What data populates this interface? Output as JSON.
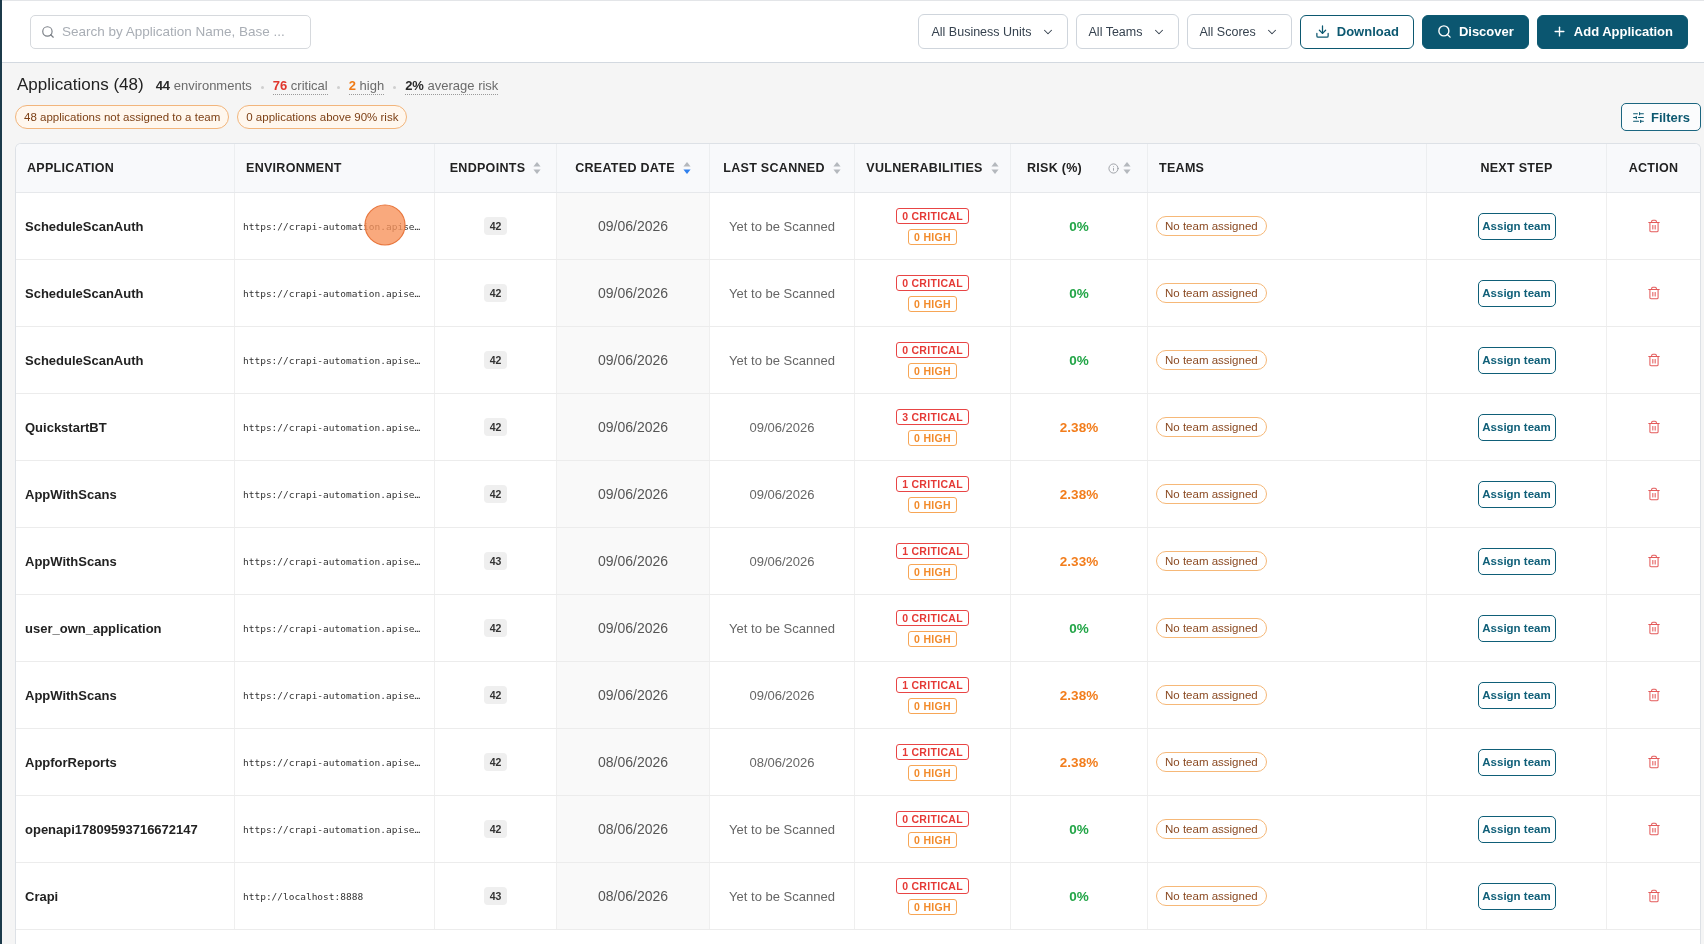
{
  "search": {
    "placeholder": "Search by Application Name, Base ..."
  },
  "filters": [
    {
      "label": "All Business Units"
    },
    {
      "label": "All Teams"
    },
    {
      "label": "All Scores"
    }
  ],
  "actions": [
    {
      "label": "Download",
      "kind": "download"
    },
    {
      "label": "Discover",
      "kind": "search"
    },
    {
      "label": "Add Application",
      "kind": "add"
    }
  ],
  "summary": {
    "title": "Applications (48)",
    "stats": [
      {
        "count": "44",
        "text": "environments",
        "color": "#2a2a2a",
        "hint": false
      },
      {
        "count": "76",
        "text": "critical",
        "color": "#e0362c",
        "hint": true
      },
      {
        "count": "2",
        "text": "high",
        "color": "#f07b16",
        "hint": true
      },
      {
        "count": "2%",
        "text": "average risk",
        "color": "#2a2a2a",
        "hint": true
      }
    ],
    "notices": [
      {
        "text": "48 applications not assigned to a team"
      },
      {
        "text": "0 applications above 90% risk"
      }
    ]
  },
  "filters_button": {
    "label": "Filters"
  },
  "table": {
    "columns": [
      {
        "label": "APPLICATION"
      },
      {
        "label": "ENVIRONMENT"
      },
      {
        "label": "ENDPOINTS",
        "sorted": false
      },
      {
        "label": "CREATED DATE",
        "sorted": true,
        "descending": true
      },
      {
        "label": "LAST SCANNED",
        "sorted": false
      },
      {
        "label": "VULNERABILITIES",
        "sorted": false
      },
      {
        "label": "RISK (%)",
        "sorted": false,
        "info": true
      },
      {
        "label": "TEAMS"
      },
      {
        "label": "NEXT STEP"
      },
      {
        "label": "ACTION"
      }
    ],
    "rows": [
      {
        "application": "ScheduleScanAuth",
        "environment": "https://crapi-automation.apise…",
        "endpoints": "42",
        "created": "09/06/2026",
        "last_scanned": "Yet to be Scanned",
        "critical": "0 CRITICAL",
        "high": "0 HIGH",
        "risk": "0%",
        "risk_elevated": false,
        "team": "No team assigned",
        "next_step": "Assign team"
      },
      {
        "application": "ScheduleScanAuth",
        "environment": "https://crapi-automation.apise…",
        "endpoints": "42",
        "created": "09/06/2026",
        "last_scanned": "Yet to be Scanned",
        "critical": "0 CRITICAL",
        "high": "0 HIGH",
        "risk": "0%",
        "risk_elevated": false,
        "team": "No team assigned",
        "next_step": "Assign team"
      },
      {
        "application": "ScheduleScanAuth",
        "environment": "https://crapi-automation.apise…",
        "endpoints": "42",
        "created": "09/06/2026",
        "last_scanned": "Yet to be Scanned",
        "critical": "0 CRITICAL",
        "high": "0 HIGH",
        "risk": "0%",
        "risk_elevated": false,
        "team": "No team assigned",
        "next_step": "Assign team"
      },
      {
        "application": "QuickstartBT",
        "environment": "https://crapi-automation.apise…",
        "endpoints": "42",
        "created": "09/06/2026",
        "last_scanned": "09/06/2026",
        "critical": "3 CRITICAL",
        "high": "0 HIGH",
        "risk": "2.38%",
        "risk_elevated": true,
        "team": "No team assigned",
        "next_step": "Assign team"
      },
      {
        "application": "AppWithScans",
        "environment": "https://crapi-automation.apise…",
        "endpoints": "42",
        "created": "09/06/2026",
        "last_scanned": "09/06/2026",
        "critical": "1 CRITICAL",
        "high": "0 HIGH",
        "risk": "2.38%",
        "risk_elevated": true,
        "team": "No team assigned",
        "next_step": "Assign team"
      },
      {
        "application": "AppWithScans",
        "environment": "https://crapi-automation.apise…",
        "endpoints": "43",
        "created": "09/06/2026",
        "last_scanned": "09/06/2026",
        "critical": "1 CRITICAL",
        "high": "0 HIGH",
        "risk": "2.33%",
        "risk_elevated": true,
        "team": "No team assigned",
        "next_step": "Assign team"
      },
      {
        "application": "user_own_application",
        "environment": "https://crapi-automation.apise…",
        "endpoints": "42",
        "created": "09/06/2026",
        "last_scanned": "Yet to be Scanned",
        "critical": "0 CRITICAL",
        "high": "0 HIGH",
        "risk": "0%",
        "risk_elevated": false,
        "team": "No team assigned",
        "next_step": "Assign team"
      },
      {
        "application": "AppWithScans",
        "environment": "https://crapi-automation.apise…",
        "endpoints": "42",
        "created": "09/06/2026",
        "last_scanned": "09/06/2026",
        "critical": "1 CRITICAL",
        "high": "0 HIGH",
        "risk": "2.38%",
        "risk_elevated": true,
        "team": "No team assigned",
        "next_step": "Assign team"
      },
      {
        "application": "AppforReports",
        "environment": "https://crapi-automation.apise…",
        "endpoints": "42",
        "created": "08/06/2026",
        "last_scanned": "08/06/2026",
        "critical": "1 CRITICAL",
        "high": "0 HIGH",
        "risk": "2.38%",
        "risk_elevated": true,
        "team": "No team assigned",
        "next_step": "Assign team"
      },
      {
        "application": "openapi17809593716672147",
        "environment": "https://crapi-automation.apise…",
        "endpoints": "42",
        "created": "08/06/2026",
        "last_scanned": "Yet to be Scanned",
        "critical": "0 CRITICAL",
        "high": "0 HIGH",
        "risk": "0%",
        "risk_elevated": false,
        "team": "No team assigned",
        "next_step": "Assign team"
      },
      {
        "application": "Crapi",
        "environment": "http://localhost:8888",
        "endpoints": "43",
        "created": "08/06/2026",
        "last_scanned": "Yet to be Scanned",
        "critical": "0 CRITICAL",
        "high": "0 HIGH",
        "risk": "0%",
        "risk_elevated": false,
        "team": "No team assigned",
        "next_step": "Assign team"
      }
    ]
  }
}
